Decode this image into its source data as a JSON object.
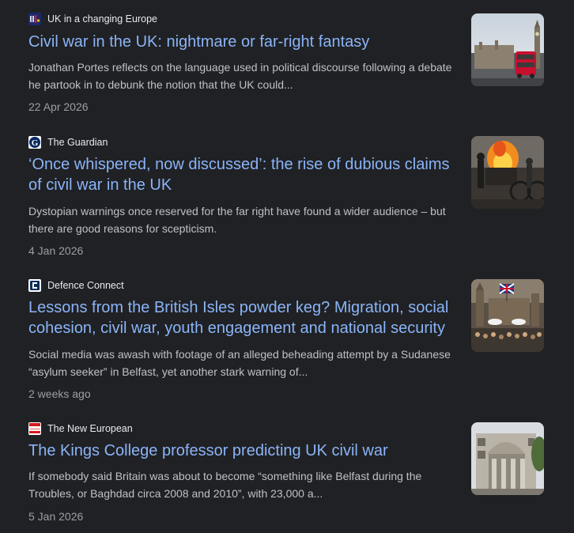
{
  "articles": [
    {
      "source": "UK in a changing Europe",
      "favicon": "uk-in-a-changing-europe-logo",
      "title": "Civil war in the UK: nightmare or far-right fantasy",
      "snippet": "Jonathan Portes reflects on the language used in political discourse following a debate he partook in to debunk the notion that the UK could...",
      "date": "22 Apr 2026",
      "thumbnail": "westminster-red-bus-photo"
    },
    {
      "source": "The Guardian",
      "favicon": "guardian-g-logo",
      "title": "‘Once whispered, now discussed’: the rise of dubious claims of civil war in the UK",
      "snippet": "Dystopian warnings once reserved for the far right have found a wider audience – but there are good reasons for scepticism.",
      "date": "4 Jan 2026",
      "thumbnail": "riot-fire-photo"
    },
    {
      "source": "Defence Connect",
      "favicon": "defence-connect-logo",
      "title": "Lessons from the British Isles powder keg? Migration, social cohesion, civil war, youth engagement and national security",
      "snippet": "Social media was awash with footage of an alleged beheading attempt by a Sudanese “asylum seeker” in Belfast, yet another stark warning of...",
      "date": "2 weeks ago",
      "thumbnail": "parliament-crowd-illustration"
    },
    {
      "source": "The New European",
      "favicon": "new-european-logo",
      "favicon_text": "THE NEW EUROPEAN",
      "title": "The Kings College professor predicting UK civil war",
      "snippet": "If somebody said Britain was about to become “something like Belfast during the Troubles, or Baghdad circa 2008 and 2010”, with 23,000 a...",
      "date": "5 Jan 2026",
      "thumbnail": "kings-college-building-photo"
    }
  ],
  "colors": {
    "background": "#202124",
    "headline": "#8ab4f8",
    "source": "#e8eaed",
    "snippet": "#bdc1c6",
    "date": "#9aa0a6"
  }
}
